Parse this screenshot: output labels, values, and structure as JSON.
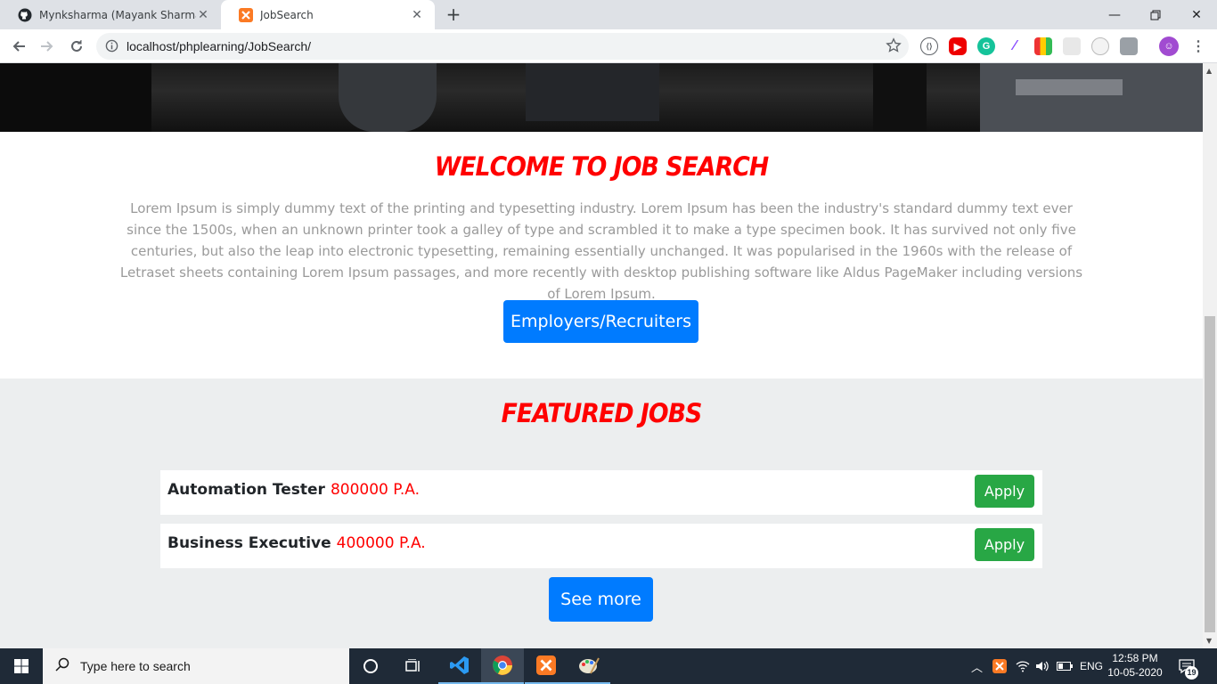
{
  "browser": {
    "tabs": [
      {
        "title": "Mynksharma (Mayank Sharma)",
        "icon": "github-icon"
      },
      {
        "title": "JobSearch",
        "icon": "xampp-icon"
      }
    ],
    "url": "localhost/phplearning/JobSearch/"
  },
  "welcome": {
    "heading": "Welcome to Job Search",
    "body": "Lorem Ipsum is simply dummy text of the printing and typesetting industry. Lorem Ipsum has been the industry's standard dummy text ever since the 1500s, when an unknown printer took a galley of type and scrambled it to make a type specimen book. It has survived not only five centuries, but also the leap into electronic typesetting, remaining essentially unchanged. It was popularised in the 1960s with the release of Letraset sheets containing Lorem Ipsum passages, and more recently with desktop publishing software like Aldus PageMaker including versions of Lorem Ipsum.",
    "cta_label": "Employers/Recruiters"
  },
  "featured": {
    "heading": "Featured Jobs",
    "jobs": [
      {
        "title": "Automation Tester",
        "salary": "800000 P.A.",
        "apply_label": "Apply"
      },
      {
        "title": "Business Executive",
        "salary": "400000 P.A.",
        "apply_label": "Apply"
      }
    ],
    "see_more_label": "See more"
  },
  "taskbar": {
    "search_placeholder": "Type here to search",
    "language": "ENG",
    "time": "12:58 PM",
    "date": "10-05-2020",
    "notification_count": "19"
  },
  "colors": {
    "accent_red": "#ff0000",
    "primary_blue": "#007bff",
    "success_green": "#28a745"
  }
}
